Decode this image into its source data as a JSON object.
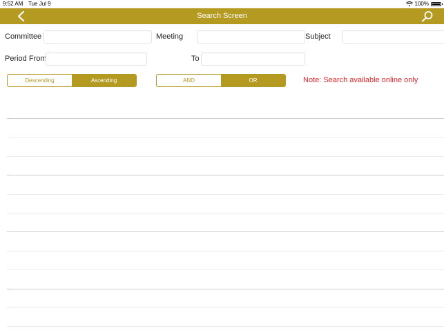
{
  "status_bar": {
    "time": "9:52 AM",
    "date": "Tue Jul 9",
    "battery_text": "100%",
    "battery_level": 1.0
  },
  "nav": {
    "title": "Search Screen",
    "back_icon": "chevron-left-icon",
    "search_icon": "magnifier-icon",
    "bar_color": "#b59a22"
  },
  "form": {
    "committee_label": "Committee",
    "committee_value": "",
    "meeting_label": "Meeting",
    "meeting_value": "",
    "subject_label": "Subject",
    "subject_value": "",
    "period_from_label": "Period From",
    "period_from_value": "",
    "to_label": "To",
    "to_value": ""
  },
  "sort_segment": {
    "options": [
      "Descending",
      "Ascending"
    ],
    "selected": "Ascending"
  },
  "logic_segment": {
    "options": [
      "AND",
      "OR"
    ],
    "selected": "OR"
  },
  "note": {
    "text": "Note: Search available online only",
    "color": "#e0272b"
  },
  "results": {
    "rows": 12
  }
}
